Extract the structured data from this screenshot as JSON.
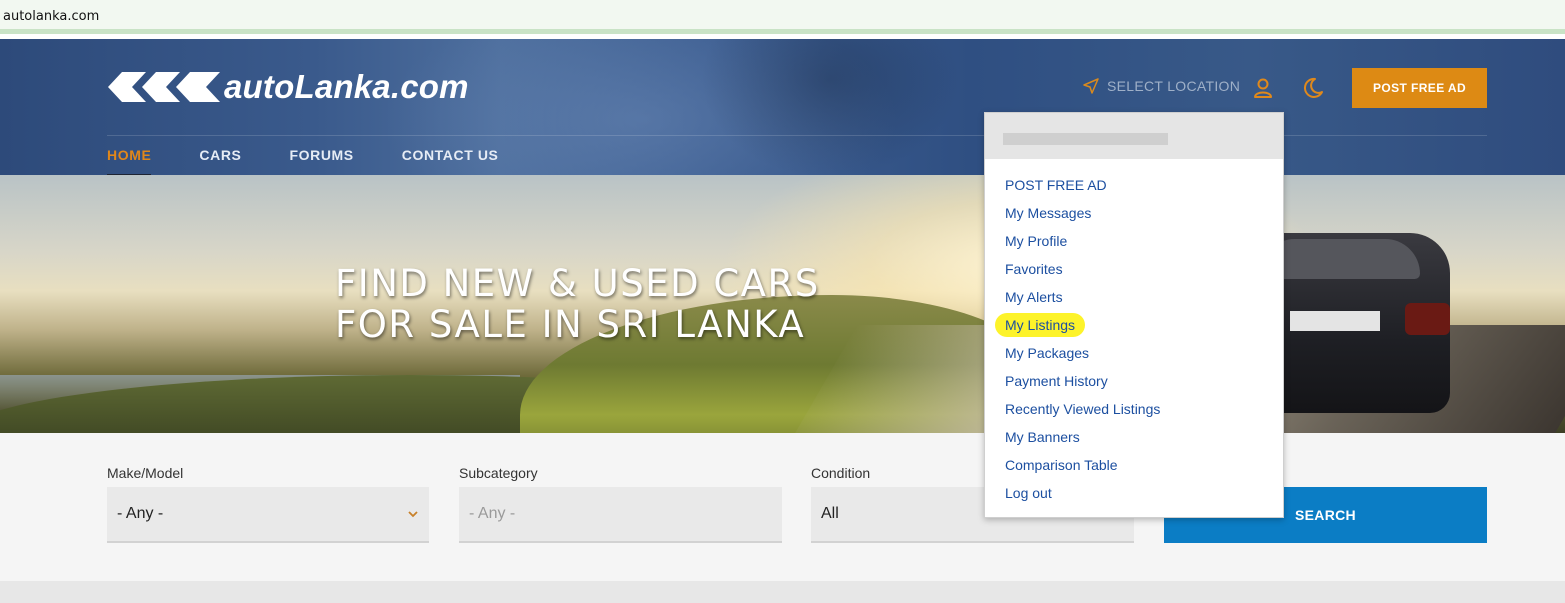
{
  "browser": {
    "url": "autolanka.com"
  },
  "header": {
    "logo_text": "autoLanka.com",
    "select_location": "SELECT LOCATION",
    "post_free_ad": "POST FREE AD",
    "nav": [
      {
        "label": "HOME",
        "active": true
      },
      {
        "label": "CARS",
        "active": false
      },
      {
        "label": "FORUMS",
        "active": false
      },
      {
        "label": "CONTACT US",
        "active": false
      }
    ]
  },
  "hero": {
    "headline_line1": "FIND NEW & USED CARS",
    "headline_line2": "FOR SALE IN SRI LANKA"
  },
  "search": {
    "make_model_label": "Make/Model",
    "make_model_value": "- Any -",
    "subcategory_label": "Subcategory",
    "subcategory_placeholder": "- Any -",
    "condition_label": "Condition",
    "condition_value": "All",
    "search_button": "SEARCH"
  },
  "user_menu": {
    "items": [
      "POST FREE AD",
      "My Messages",
      "My Profile",
      "Favorites",
      "My Alerts",
      "My Listings",
      "My Packages",
      "Payment History",
      "Recently Viewed Listings",
      "My Banners",
      "Comparison Table",
      "Log out"
    ],
    "highlighted_item": "My Listings"
  },
  "colors": {
    "accent_orange": "#dd8a14",
    "search_blue": "#0b7dc5",
    "menu_link": "#1c4fa0",
    "highlight_yellow": "#fdf32a"
  }
}
